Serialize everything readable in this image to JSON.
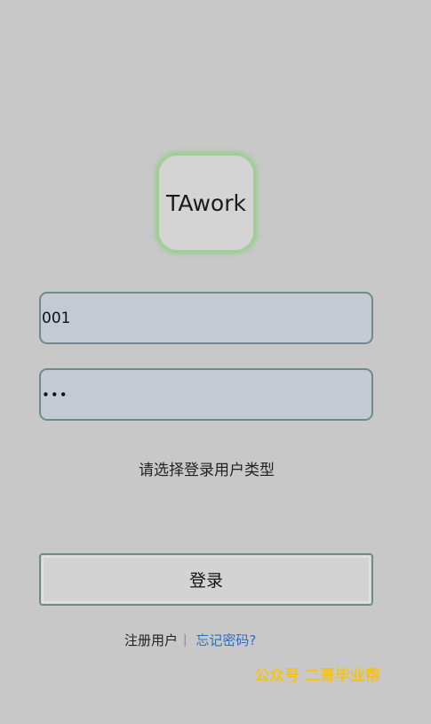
{
  "app": {
    "logo_text": "TAwork"
  },
  "login_form": {
    "username_value": "001",
    "password_value": "•••",
    "user_type_prompt": "请选择登录用户类型",
    "login_button_label": "登录"
  },
  "footer_links": {
    "register_label": "注册用户",
    "separator": "|",
    "forgot_password_label": "忘记密码?"
  },
  "watermark": {
    "text": "公众号 二哥毕业帮"
  },
  "colors": {
    "background": "#c8c8c8",
    "logo_glow": "#9fcf94",
    "input_background": "#c3cad3",
    "input_border": "#6f8c8a",
    "link": "#2b6fc6",
    "watermark": "#f3c21b"
  }
}
